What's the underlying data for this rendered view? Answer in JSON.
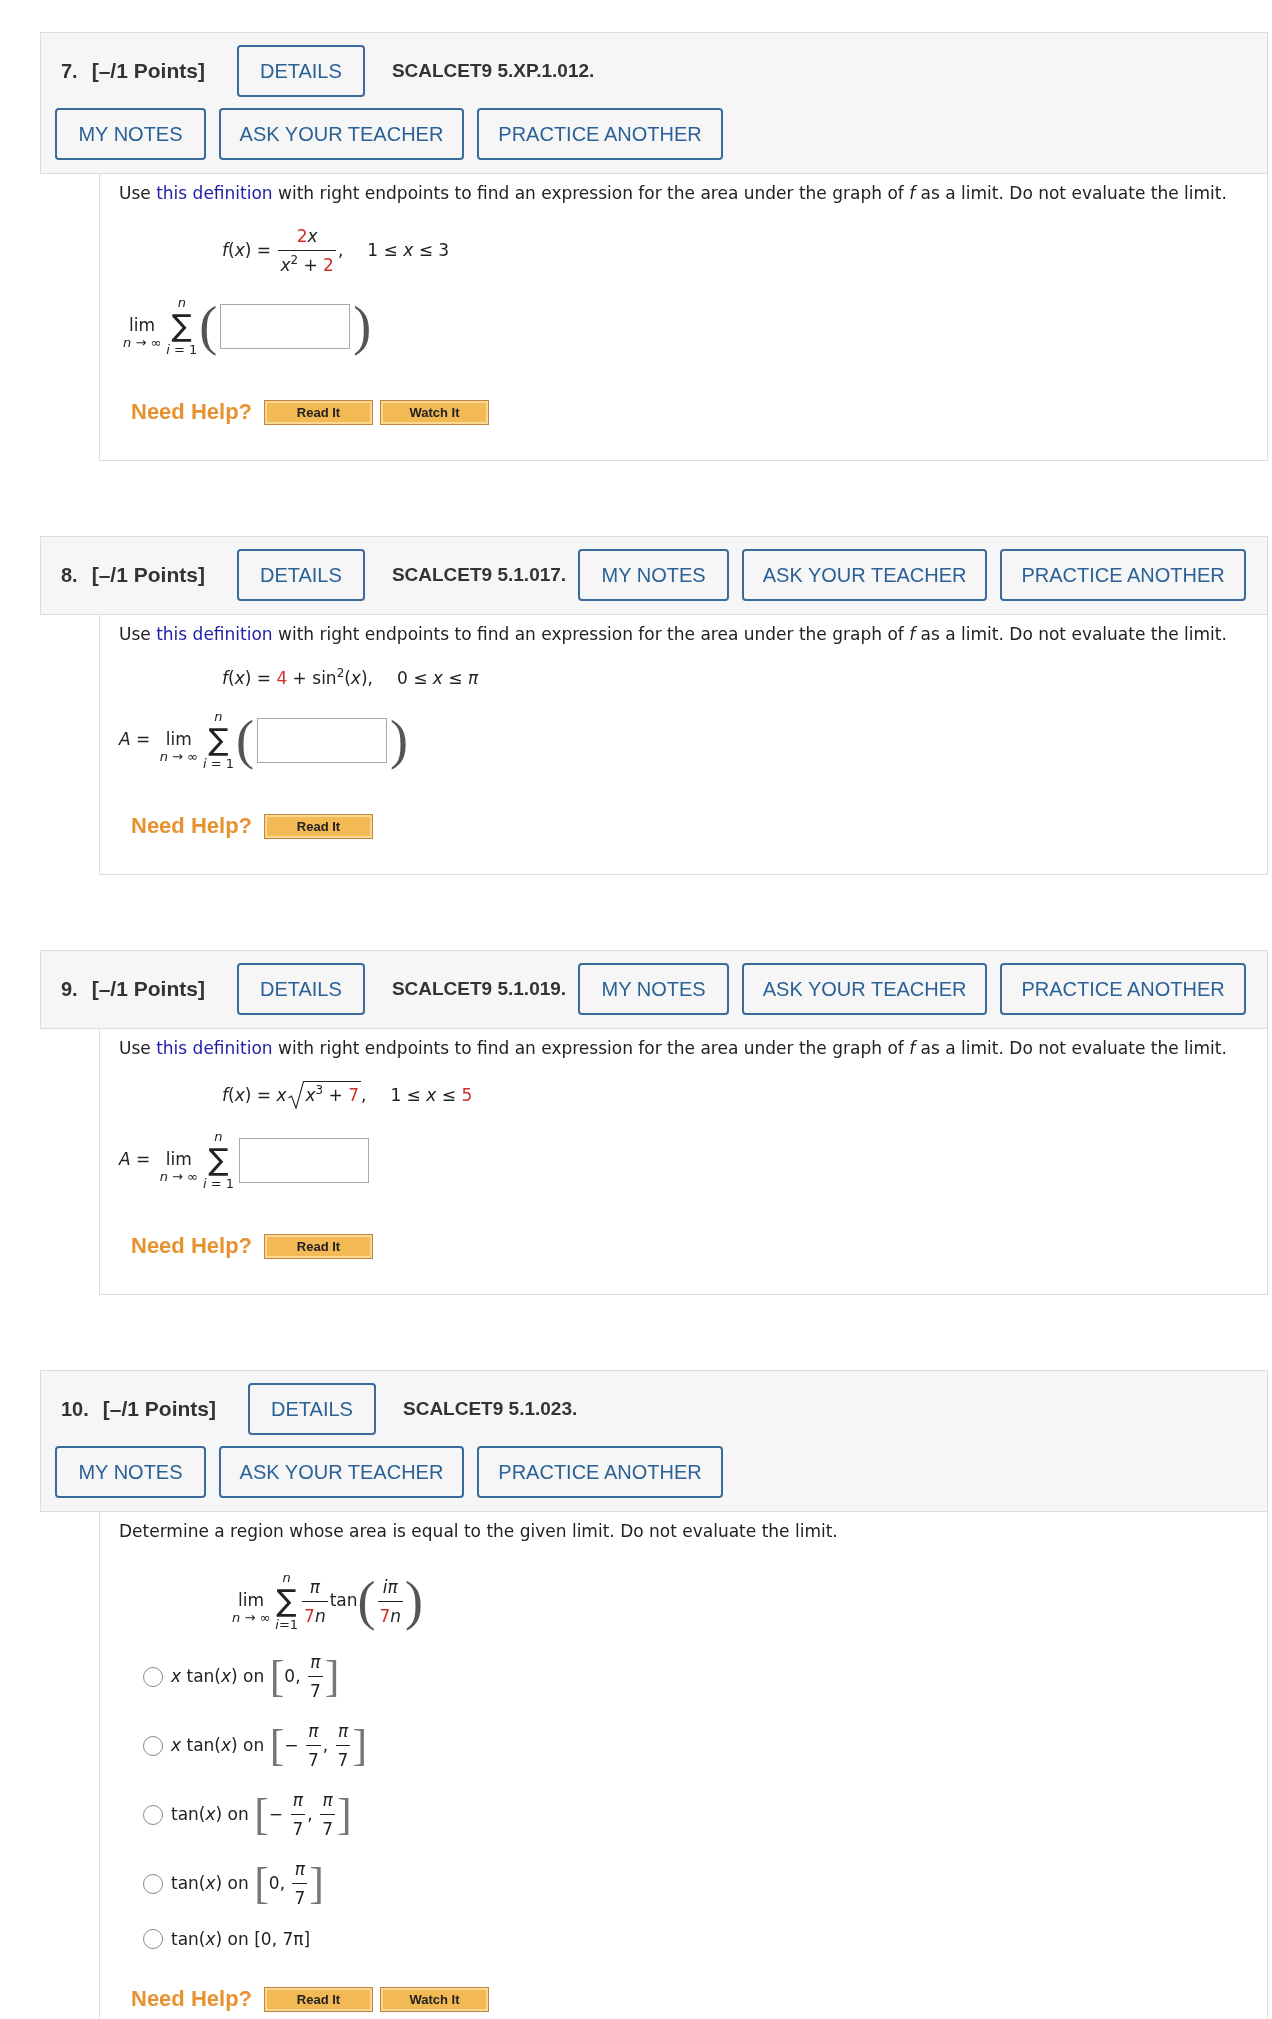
{
  "questions": [
    {
      "number": "7.",
      "points": "[–/1 Points]",
      "details": "DETAILS",
      "code": "SCALCET9 5.XP.1.012.",
      "actions": [
        "MY NOTES",
        "ASK YOUR TEACHER",
        "PRACTICE ANOTHER"
      ],
      "prompt": [
        {
          "kind": "text",
          "text": "Use "
        },
        {
          "kind": "link",
          "text": "this definition"
        },
        {
          "kind": "text",
          "text": " with right endpoints to find an expression for the area under the graph of *f* as a limit. Do not evaluate the limit."
        }
      ],
      "function": {
        "expr": [
          {
            "kind": "text",
            "text": "*f*(*x*) = "
          },
          {
            "kind": "frac",
            "num": [
              {
                "kind": "param",
                "text": "2"
              },
              {
                "kind": "text",
                "text": "*x*"
              }
            ],
            "den": [
              {
                "kind": "text",
                "text": "*x*$^{2}$ + "
              },
              {
                "kind": "param",
                "text": "2"
              }
            ]
          },
          {
            "kind": "text",
            "text": ","
          }
        ],
        "domain": [
          {
            "kind": "text",
            "text": "1 ≤ *x* ≤ 3"
          }
        ]
      },
      "answer": [
        {
          "kind": "lim",
          "text": "lim",
          "under": "*n* → ∞"
        },
        {
          "kind": "sum",
          "symbol": "∑",
          "upper": "*n*",
          "lower": "*i* = 1"
        },
        {
          "kind": "paren",
          "open": "(",
          "close": ")",
          "body": [
            {
              "kind": "input"
            }
          ]
        }
      ],
      "help": {
        "label": "Need Help?",
        "buttons": [
          "Read It",
          "Watch It"
        ]
      }
    },
    {
      "number": "8.",
      "points": "[–/1 Points]",
      "details": "DETAILS",
      "code": "SCALCET9 5.1.017.",
      "actions": [
        "MY NOTES",
        "ASK YOUR TEACHER",
        "PRACTICE ANOTHER"
      ],
      "prompt": [
        {
          "kind": "text",
          "text": "Use "
        },
        {
          "kind": "link",
          "text": "this definition"
        },
        {
          "kind": "text",
          "text": " with right endpoints to find an expression for the area under the graph of *f* as a limit. Do not evaluate the limit."
        }
      ],
      "function": {
        "expr": [
          {
            "kind": "text",
            "text": "*f*(*x*) = "
          },
          {
            "kind": "param",
            "text": "4"
          },
          {
            "kind": "text",
            "text": " + sin$^{2}$(*x*),"
          }
        ],
        "domain": [
          {
            "kind": "text",
            "text": "0 ≤ *x* ≤ *π*"
          }
        ]
      },
      "answer": [
        {
          "kind": "text",
          "text": "*A* = "
        },
        {
          "kind": "lim",
          "text": "lim",
          "under": "*n* → ∞"
        },
        {
          "kind": "sum",
          "symbol": "∑",
          "upper": "*n*",
          "lower": "*i* = 1"
        },
        {
          "kind": "paren",
          "open": "(",
          "close": ")",
          "body": [
            {
              "kind": "input"
            }
          ]
        }
      ],
      "help": {
        "label": "Need Help?",
        "buttons": [
          "Read It"
        ]
      }
    },
    {
      "number": "9.",
      "points": "[–/1 Points]",
      "details": "DETAILS",
      "code": "SCALCET9 5.1.019.",
      "actions": [
        "MY NOTES",
        "ASK YOUR TEACHER",
        "PRACTICE ANOTHER"
      ],
      "prompt": [
        {
          "kind": "text",
          "text": "Use "
        },
        {
          "kind": "link",
          "text": "this definition"
        },
        {
          "kind": "text",
          "text": " with right endpoints to find an expression for the area under the graph of *f* as a limit. Do not evaluate the limit."
        }
      ],
      "function": {
        "expr": [
          {
            "kind": "text",
            "text": "*f*(*x*) = *x*"
          },
          {
            "kind": "sqrt",
            "body": [
              {
                "kind": "text",
                "text": "*x*$^{3}$ + "
              },
              {
                "kind": "param",
                "text": "7"
              }
            ]
          },
          {
            "kind": "text",
            "text": ","
          }
        ],
        "domain": [
          {
            "kind": "text",
            "text": "1 ≤ *x* ≤ "
          },
          {
            "kind": "param",
            "text": "5"
          }
        ]
      },
      "answer": [
        {
          "kind": "text",
          "text": "*A* = "
        },
        {
          "kind": "lim",
          "text": "lim",
          "under": "*n* → ∞"
        },
        {
          "kind": "sum",
          "symbol": "∑",
          "upper": "*n*",
          "lower": "*i* = 1"
        },
        {
          "kind": "input"
        }
      ],
      "help": {
        "label": "Need Help?",
        "buttons": [
          "Read It"
        ]
      }
    },
    {
      "number": "10.",
      "points": "[–/1 Points]",
      "details": "DETAILS",
      "code": "SCALCET9 5.1.023.",
      "actions": [
        "MY NOTES",
        "ASK YOUR TEACHER",
        "PRACTICE ANOTHER"
      ],
      "prompt": [
        {
          "kind": "text",
          "text": "Determine a region whose area is equal to the given limit. Do not evaluate the limit."
        }
      ],
      "limit": [
        {
          "kind": "lim",
          "text": "lim",
          "under": "*n* → ∞"
        },
        {
          "kind": "sum",
          "symbol": "∑",
          "upper": "*n*",
          "lower": "*i*=1"
        },
        {
          "kind": "frac",
          "num": [
            {
              "kind": "text",
              "text": "*π*"
            }
          ],
          "den": [
            {
              "kind": "param",
              "text": "7"
            },
            {
              "kind": "text",
              "text": "*n*"
            }
          ]
        },
        {
          "kind": "text",
          "text": "tan"
        },
        {
          "kind": "paren",
          "open": "(",
          "close": ")",
          "body": [
            {
              "kind": "frac",
              "num": [
                {
                  "kind": "text",
                  "text": "*iπ*"
                }
              ],
              "den": [
                {
                  "kind": "param",
                  "text": "7"
                },
                {
                  "kind": "text",
                  "text": "*n*"
                }
              ]
            }
          ]
        }
      ],
      "choices": [
        {
          "selected": false,
          "label": [
            {
              "kind": "text",
              "text": "*x* tan(*x*) on "
            },
            {
              "kind": "bracket",
              "open": "[",
              "close": "]",
              "body": [
                {
                  "kind": "text",
                  "text": "0, "
                },
                {
                  "kind": "frac",
                  "num": [
                    {
                      "kind": "text",
                      "text": "*π*"
                    }
                  ],
                  "den": [
                    {
                      "kind": "text",
                      "text": "7"
                    }
                  ]
                }
              ]
            }
          ]
        },
        {
          "selected": false,
          "label": [
            {
              "kind": "text",
              "text": "*x* tan(*x*) on "
            },
            {
              "kind": "bracket",
              "open": "[",
              "close": "]",
              "body": [
                {
                  "kind": "text",
                  "text": "− "
                },
                {
                  "kind": "frac",
                  "num": [
                    {
                      "kind": "text",
                      "text": "*π*"
                    }
                  ],
                  "den": [
                    {
                      "kind": "text",
                      "text": "7"
                    }
                  ]
                },
                {
                  "kind": "text",
                  "text": ", "
                },
                {
                  "kind": "frac",
                  "num": [
                    {
                      "kind": "text",
                      "text": "*π*"
                    }
                  ],
                  "den": [
                    {
                      "kind": "text",
                      "text": "7"
                    }
                  ]
                }
              ]
            }
          ]
        },
        {
          "selected": false,
          "label": [
            {
              "kind": "text",
              "text": "tan(*x*) on "
            },
            {
              "kind": "bracket",
              "open": "[",
              "close": "]",
              "body": [
                {
                  "kind": "text",
                  "text": "− "
                },
                {
                  "kind": "frac",
                  "num": [
                    {
                      "kind": "text",
                      "text": "*π*"
                    }
                  ],
                  "den": [
                    {
                      "kind": "text",
                      "text": "7"
                    }
                  ]
                },
                {
                  "kind": "text",
                  "text": ", "
                },
                {
                  "kind": "frac",
                  "num": [
                    {
                      "kind": "text",
                      "text": "*π*"
                    }
                  ],
                  "den": [
                    {
                      "kind": "text",
                      "text": "7"
                    }
                  ]
                }
              ]
            }
          ]
        },
        {
          "selected": false,
          "label": [
            {
              "kind": "text",
              "text": "tan(*x*) on "
            },
            {
              "kind": "bracket",
              "open": "[",
              "close": "]",
              "body": [
                {
                  "kind": "text",
                  "text": "0, "
                },
                {
                  "kind": "frac",
                  "num": [
                    {
                      "kind": "text",
                      "text": "*π*"
                    }
                  ],
                  "den": [
                    {
                      "kind": "text",
                      "text": "7"
                    }
                  ]
                }
              ]
            }
          ]
        },
        {
          "selected": false,
          "label": [
            {
              "kind": "text",
              "text": "tan(*x*) on [0, 7π]"
            }
          ]
        }
      ],
      "help": {
        "label": "Need Help?",
        "buttons": [
          "Read It",
          "Watch It"
        ]
      }
    }
  ]
}
